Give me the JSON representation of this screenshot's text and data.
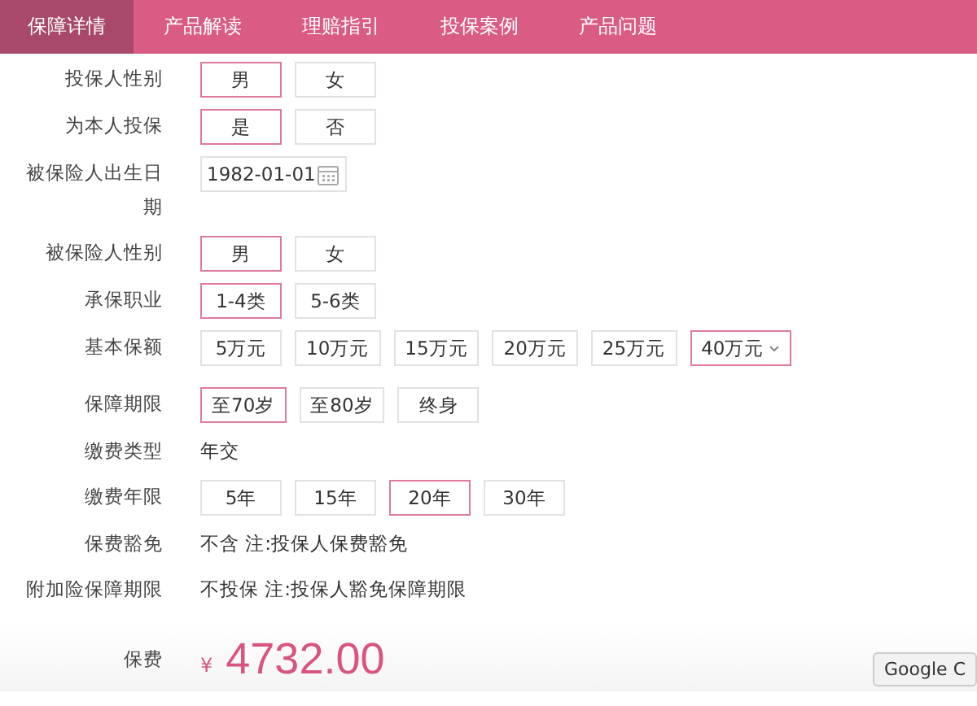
{
  "tabs": [
    {
      "label": "保障详情",
      "selected": true
    },
    {
      "label": "产品解读",
      "selected": false
    },
    {
      "label": "理赔指引",
      "selected": false
    },
    {
      "label": "投保案例",
      "selected": false
    },
    {
      "label": "产品问题",
      "selected": false
    }
  ],
  "rows": [
    {
      "kind": "options",
      "label": "投保人性别",
      "options": [
        {
          "label": "男",
          "selected": true
        },
        {
          "label": "女",
          "selected": false
        }
      ]
    },
    {
      "kind": "options",
      "label": "为本人投保",
      "options": [
        {
          "label": "是",
          "selected": true
        },
        {
          "label": "否",
          "selected": false
        }
      ]
    },
    {
      "kind": "date",
      "label": "被保险人出生日期",
      "value": "1982-01-01"
    },
    {
      "kind": "options",
      "label": "被保险人性别",
      "options": [
        {
          "label": "男",
          "selected": true
        },
        {
          "label": "女",
          "selected": false
        }
      ]
    },
    {
      "kind": "options",
      "label": "承保职业",
      "options": [
        {
          "label": "1-4类",
          "selected": true
        },
        {
          "label": "5-6类",
          "selected": false
        }
      ]
    },
    {
      "kind": "options",
      "label": "基本保额",
      "options": [
        {
          "label": "5万元",
          "selected": false
        },
        {
          "label": "10万元",
          "selected": false
        },
        {
          "label": "15万元",
          "selected": false
        },
        {
          "label": "20万元",
          "selected": false
        },
        {
          "label": "25万元",
          "selected": false
        },
        {
          "label": "40万元",
          "selected": true,
          "dropdown": true
        }
      ]
    },
    {
      "kind": "options",
      "label": "保障期限",
      "options": [
        {
          "label": "至70岁",
          "selected": true
        },
        {
          "label": "至80岁",
          "selected": false
        },
        {
          "label": "终身",
          "selected": false
        }
      ]
    },
    {
      "kind": "text",
      "label": "缴费类型",
      "value": "年交"
    },
    {
      "kind": "options",
      "label": "缴费年限",
      "options": [
        {
          "label": "5年",
          "selected": false
        },
        {
          "label": "15年",
          "selected": false
        },
        {
          "label": "20年",
          "selected": true
        },
        {
          "label": "30年",
          "selected": false
        }
      ]
    },
    {
      "kind": "text",
      "label": "保费豁免",
      "value": "不含 注:投保人保费豁免"
    },
    {
      "kind": "text",
      "label": "附加险保障期限",
      "value": "不投保 注:投保人豁免保障期限"
    }
  ],
  "premium": {
    "label": "保费",
    "currency": "¥",
    "amount": "4732.00"
  },
  "tooltip": "Google C"
}
